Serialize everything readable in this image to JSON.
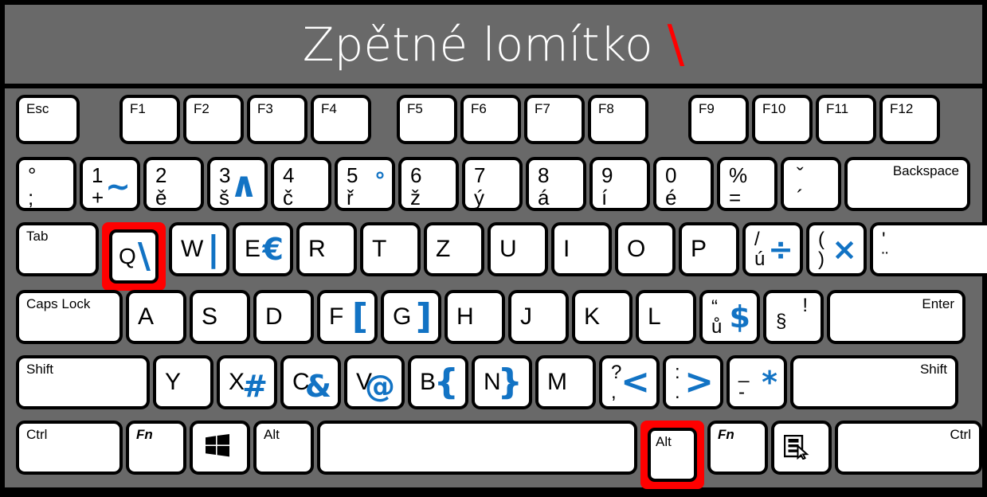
{
  "title": {
    "text": "Zpětné lomítko",
    "symbol": "\\",
    "symbol_color": "#ff0000",
    "text_color": "#ffffff",
    "background": "#696969"
  },
  "theme": {
    "body_background": "#000000",
    "keyboard_background": "#696969",
    "key_face": "#ffffff",
    "key_border": "#000000",
    "altgr_color": "#1273c4",
    "highlight_color": "#ff0000"
  },
  "highlighted_keys": [
    "Q",
    "Alt-right"
  ],
  "rows": {
    "function": [
      {
        "name": "esc",
        "label": "Esc"
      },
      {
        "name": "f1",
        "label": "F1"
      },
      {
        "name": "f2",
        "label": "F2"
      },
      {
        "name": "f3",
        "label": "F3"
      },
      {
        "name": "f4",
        "label": "F4"
      },
      {
        "name": "f5",
        "label": "F5"
      },
      {
        "name": "f6",
        "label": "F6"
      },
      {
        "name": "f7",
        "label": "F7"
      },
      {
        "name": "f8",
        "label": "F8"
      },
      {
        "name": "f9",
        "label": "F9"
      },
      {
        "name": "f10",
        "label": "F10"
      },
      {
        "name": "f11",
        "label": "F11"
      },
      {
        "name": "f12",
        "label": "F12"
      }
    ],
    "number": [
      {
        "name": "semicolon",
        "upper": "°",
        "lower": ";",
        "altgr": ""
      },
      {
        "name": "digit1",
        "upper": "1",
        "lower": "+",
        "altgr": "~"
      },
      {
        "name": "digit2",
        "upper": "2",
        "lower": "ě",
        "altgr": ""
      },
      {
        "name": "digit3",
        "upper": "3",
        "lower": "š",
        "altgr": "∧"
      },
      {
        "name": "digit4",
        "upper": "4",
        "lower": "č",
        "altgr": ""
      },
      {
        "name": "digit5",
        "upper": "5",
        "lower": "ř",
        "altgr": "°"
      },
      {
        "name": "digit6",
        "upper": "6",
        "lower": "ž",
        "altgr": ""
      },
      {
        "name": "digit7",
        "upper": "7",
        "lower": "ý",
        "altgr": ""
      },
      {
        "name": "digit8",
        "upper": "8",
        "lower": "á",
        "altgr": ""
      },
      {
        "name": "digit9",
        "upper": "9",
        "lower": "í",
        "altgr": ""
      },
      {
        "name": "digit0",
        "upper": "0",
        "lower": "é",
        "altgr": ""
      },
      {
        "name": "percent",
        "upper": "%",
        "lower": "=",
        "altgr": ""
      },
      {
        "name": "caron",
        "upper": "ˇ",
        "lower": "´",
        "altgr": ""
      },
      {
        "name": "backspace",
        "label": "Backspace"
      }
    ],
    "qwertz": [
      {
        "name": "tab",
        "label": "Tab"
      },
      {
        "name": "q",
        "letter": "Q",
        "altgr": "\\",
        "highlight": true
      },
      {
        "name": "w",
        "letter": "W",
        "altgr": "|"
      },
      {
        "name": "e",
        "letter": "E",
        "altgr": "€"
      },
      {
        "name": "r",
        "letter": "R",
        "altgr": ""
      },
      {
        "name": "t",
        "letter": "T",
        "altgr": ""
      },
      {
        "name": "z",
        "letter": "Z",
        "altgr": ""
      },
      {
        "name": "u",
        "letter": "U",
        "altgr": ""
      },
      {
        "name": "i",
        "letter": "I",
        "altgr": ""
      },
      {
        "name": "o",
        "letter": "O",
        "altgr": ""
      },
      {
        "name": "p",
        "letter": "P",
        "altgr": ""
      },
      {
        "name": "slash-u",
        "upper": "/",
        "lower": "ú",
        "altgr": "÷"
      },
      {
        "name": "paren",
        "upper": "(",
        "lower": ")",
        "altgr": "×"
      },
      {
        "name": "quote",
        "upper": "'",
        "lower": "¨",
        "altgr": ""
      }
    ],
    "home": [
      {
        "name": "caps-lock",
        "label": "Caps Lock"
      },
      {
        "name": "a",
        "letter": "A",
        "altgr": ""
      },
      {
        "name": "s",
        "letter": "S",
        "altgr": ""
      },
      {
        "name": "d",
        "letter": "D",
        "altgr": ""
      },
      {
        "name": "f",
        "letter": "F",
        "altgr": "["
      },
      {
        "name": "g",
        "letter": "G",
        "altgr": "]"
      },
      {
        "name": "h",
        "letter": "H",
        "altgr": ""
      },
      {
        "name": "j",
        "letter": "J",
        "altgr": ""
      },
      {
        "name": "k",
        "letter": "K",
        "altgr": ""
      },
      {
        "name": "l",
        "letter": "L",
        "altgr": ""
      },
      {
        "name": "uring",
        "upper": "“",
        "lower": "ů",
        "altgr": "$"
      },
      {
        "name": "section",
        "upper": "!",
        "lower": "§",
        "altgr": ""
      },
      {
        "name": "enter",
        "label": "Enter"
      }
    ],
    "shift": [
      {
        "name": "shift-left",
        "label": "Shift"
      },
      {
        "name": "y",
        "letter": "Y",
        "altgr": ""
      },
      {
        "name": "x",
        "letter": "X",
        "altgr": "#"
      },
      {
        "name": "c",
        "letter": "C",
        "altgr": "&"
      },
      {
        "name": "v",
        "letter": "V",
        "altgr": "@"
      },
      {
        "name": "b",
        "letter": "B",
        "altgr": "{"
      },
      {
        "name": "n",
        "letter": "N",
        "altgr": "}"
      },
      {
        "name": "m",
        "letter": "M",
        "altgr": ""
      },
      {
        "name": "comma",
        "upper": "?",
        "lower": ",",
        "altgr": "<"
      },
      {
        "name": "period",
        "upper": ":",
        "lower": ".",
        "altgr": ">"
      },
      {
        "name": "dash",
        "upper": "_",
        "lower": "-",
        "altgr": "*"
      },
      {
        "name": "shift-right",
        "label": "Shift"
      }
    ],
    "bottom": [
      {
        "name": "ctrl-left",
        "label": "Ctrl"
      },
      {
        "name": "fn-left",
        "label": "Fn"
      },
      {
        "name": "windows",
        "icon": "windows-icon"
      },
      {
        "name": "alt-left",
        "label": "Alt"
      },
      {
        "name": "space",
        "label": ""
      },
      {
        "name": "alt-right",
        "label": "Alt",
        "highlight": true
      },
      {
        "name": "fn-right",
        "label": "Fn"
      },
      {
        "name": "menu",
        "icon": "context-menu-icon"
      },
      {
        "name": "ctrl-right",
        "label": "Ctrl"
      }
    ]
  }
}
